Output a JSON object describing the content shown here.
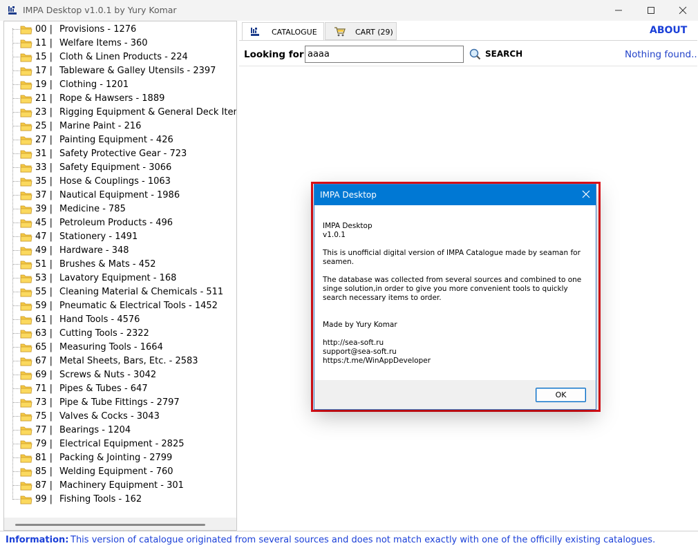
{
  "window": {
    "title": "IMPA Desktop v1.0.1 by Yury Komar"
  },
  "tabs": {
    "catalogue": "CATALOGUE",
    "cart": "CART (29)"
  },
  "about_label": "ABOUT",
  "search": {
    "label": "Looking for",
    "value": "aaaa",
    "button_label": "SEARCH",
    "status": "Nothing found..."
  },
  "categories": [
    {
      "code": "00  |",
      "name": "Provisions - 1276"
    },
    {
      "code": "11  |",
      "name": "Welfare Items - 360"
    },
    {
      "code": "15  |",
      "name": "Cloth & Linen Products - 224"
    },
    {
      "code": "17  |",
      "name": "Tableware & Galley Utensils - 2397"
    },
    {
      "code": "19  |",
      "name": "Clothing - 1201"
    },
    {
      "code": "21  |",
      "name": "Rope & Hawsers - 1889"
    },
    {
      "code": "23  |",
      "name": "Rigging Equipment & General Deck Items -"
    },
    {
      "code": "25  |",
      "name": "Marine Paint - 216"
    },
    {
      "code": "27  |",
      "name": "Painting Equipment - 426"
    },
    {
      "code": "31  |",
      "name": "Safety Protective Gear - 723"
    },
    {
      "code": "33  |",
      "name": "Safety Equipment - 3066"
    },
    {
      "code": "35  |",
      "name": "Hose & Couplings - 1063"
    },
    {
      "code": "37  |",
      "name": "Nautical Equipment - 1986"
    },
    {
      "code": "39  |",
      "name": "Medicine - 785"
    },
    {
      "code": "45  |",
      "name": "Petroleum Products  - 496"
    },
    {
      "code": "47  |",
      "name": "Stationery - 1491"
    },
    {
      "code": "49  |",
      "name": "Hardware - 348"
    },
    {
      "code": "51  |",
      "name": "Brushes & Mats - 452"
    },
    {
      "code": "53  |",
      "name": "Lavatory Equipment - 168"
    },
    {
      "code": "55  |",
      "name": "Cleaning Material & Chemicals - 511"
    },
    {
      "code": "59  |",
      "name": "Pneumatic & Electrical Tools - 1452"
    },
    {
      "code": "61  |",
      "name": "Hand Tools - 4576"
    },
    {
      "code": "63  |",
      "name": "Cutting Tools - 2322"
    },
    {
      "code": "65  |",
      "name": "Measuring Tools - 1664"
    },
    {
      "code": "67  |",
      "name": "Metal Sheets, Bars, Etc. - 2583"
    },
    {
      "code": "69  |",
      "name": "Screws & Nuts - 3042"
    },
    {
      "code": "71  |",
      "name": "Pipes & Tubes - 647"
    },
    {
      "code": "73  |",
      "name": "Pipe & Tube Fittings - 2797"
    },
    {
      "code": "75  |",
      "name": "Valves & Cocks - 3043"
    },
    {
      "code": "77  |",
      "name": "Bearings - 1204"
    },
    {
      "code": "79  |",
      "name": "Electrical Equipment - 2825"
    },
    {
      "code": "81  |",
      "name": "Packing & Jointing - 2799"
    },
    {
      "code": "85  |",
      "name": "Welding Equipment - 760"
    },
    {
      "code": "87  |",
      "name": "Machinery Equipment - 301"
    },
    {
      "code": "99  |",
      "name": "Fishing Tools - 162"
    }
  ],
  "info": {
    "label": "Information:",
    "text": "This version of catalogue originated from several sources and does not match exactly with one of the officilly existing catalogues."
  },
  "dialog": {
    "title": "IMPA Desktop",
    "lines": [
      "IMPA Desktop",
      "v1.0.1",
      "This is unofficial digital version of IMPA Catalogue made by seaman for",
      "seamen.",
      "The database was collected from several sources and combined to one",
      "singe solution,in order to give you more convenient tools to quickly",
      "search necessary items to order.",
      "Made by Yury Komar",
      "http://sea-soft.ru",
      "support@sea-soft.ru",
      "https:/t.me/WinAppDeveloper"
    ],
    "ok_label": "OK"
  },
  "colors": {
    "link_blue": "#1a3fd8",
    "dialog_titlebar": "#0078d4",
    "highlight_red": "#e10f17",
    "folder_yellow": "#f5c842"
  }
}
